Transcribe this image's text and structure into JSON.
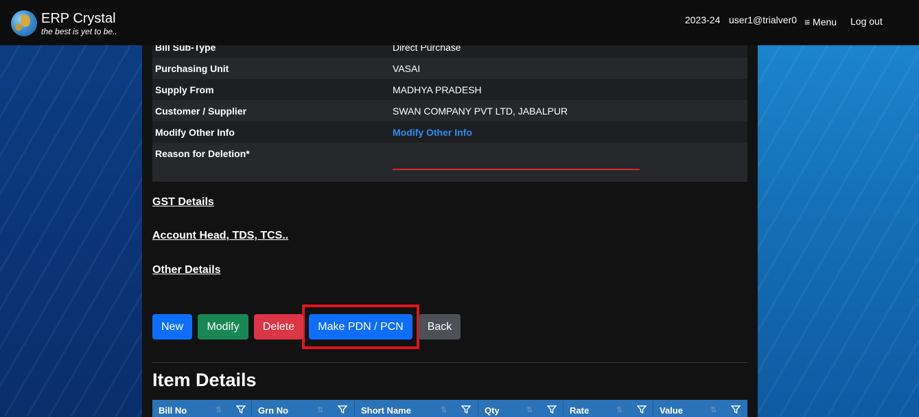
{
  "header": {
    "app_name": "ERP Crystal",
    "tagline": "the best is yet to be..",
    "fiscal_year": "2023-24",
    "user": "user1@trialver0",
    "menu_label": "≡ Menu",
    "logout_label": "Log out"
  },
  "info_rows": [
    {
      "label": "Bill Sub-Type",
      "value": "Direct Purchase"
    },
    {
      "label": "Purchasing Unit",
      "value": "VASAI"
    },
    {
      "label": "Supply From",
      "value": "MADHYA PRADESH"
    },
    {
      "label": "Customer / Supplier",
      "value": "SWAN COMPANY PVT LTD, JABALPUR"
    },
    {
      "label": "Modify Other Info",
      "value": "Modify Other Info"
    },
    {
      "label": "Reason for Deletion*",
      "value": ""
    }
  ],
  "sections": {
    "gst": "GST Details",
    "account": "Account Head, TDS, TCS..",
    "other": "Other Details"
  },
  "buttons": {
    "new": "New",
    "modify": "Modify",
    "delete": "Delete",
    "make_pdn": "Make PDN / PCN",
    "back": "Back"
  },
  "item_details": {
    "title": "Item Details",
    "columns": [
      "Bill No",
      "Grn No",
      "Short Name",
      "Qty",
      "Rate",
      "Value"
    ]
  },
  "colors": {
    "primary": "#0d6efd",
    "success": "#198754",
    "danger": "#dc3545",
    "secondary": "#4d5157",
    "link": "#2f8cf0",
    "grid_header": "#2b73b8"
  }
}
